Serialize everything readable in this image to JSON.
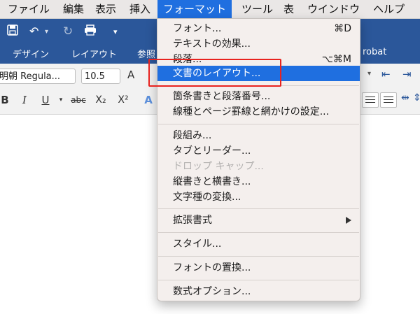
{
  "menubar": {
    "items": [
      "ファイル",
      "編集",
      "表示",
      "挿入",
      "フォーマット",
      "ツール",
      "表",
      "ウインドウ",
      "ヘルプ"
    ],
    "active": "フォーマット"
  },
  "ribbon": {
    "tabs": [
      "デザイン",
      "レイアウト",
      "参照",
      "robat"
    ],
    "font_name": "明朝 Regula...",
    "font_size": "10.5",
    "grow_font": "A",
    "bold": "B",
    "italic": "I",
    "underline": "U",
    "strike": "abc",
    "subscript": "X₂",
    "superscript": "X²",
    "text_effects": "A"
  },
  "format_menu": {
    "items": [
      {
        "label": "フォント...",
        "shortcut": "⌘D"
      },
      {
        "label": "テキストの効果..."
      },
      {
        "label": "段落...",
        "shortcut": "⌥⌘M"
      },
      {
        "label": "文書のレイアウト...",
        "highlighted": true
      },
      {
        "label": "箇条書きと段落番号..."
      },
      {
        "label": "線種とページ罫線と網かけの設定..."
      },
      {
        "label": "段組み..."
      },
      {
        "label": "タブとリーダー..."
      },
      {
        "label": "ドロップ キャップ...",
        "disabled": true
      },
      {
        "label": "縦書きと横書き..."
      },
      {
        "label": "文字種の変換..."
      },
      {
        "label": "拡張書式",
        "submenu": true
      },
      {
        "label": "スタイル..."
      },
      {
        "label": "フォントの置換..."
      },
      {
        "label": "数式オプション..."
      }
    ]
  },
  "colors": {
    "accent": "#1f6fe0",
    "word_blue": "#2b579a",
    "annotation": "#e8231f"
  }
}
